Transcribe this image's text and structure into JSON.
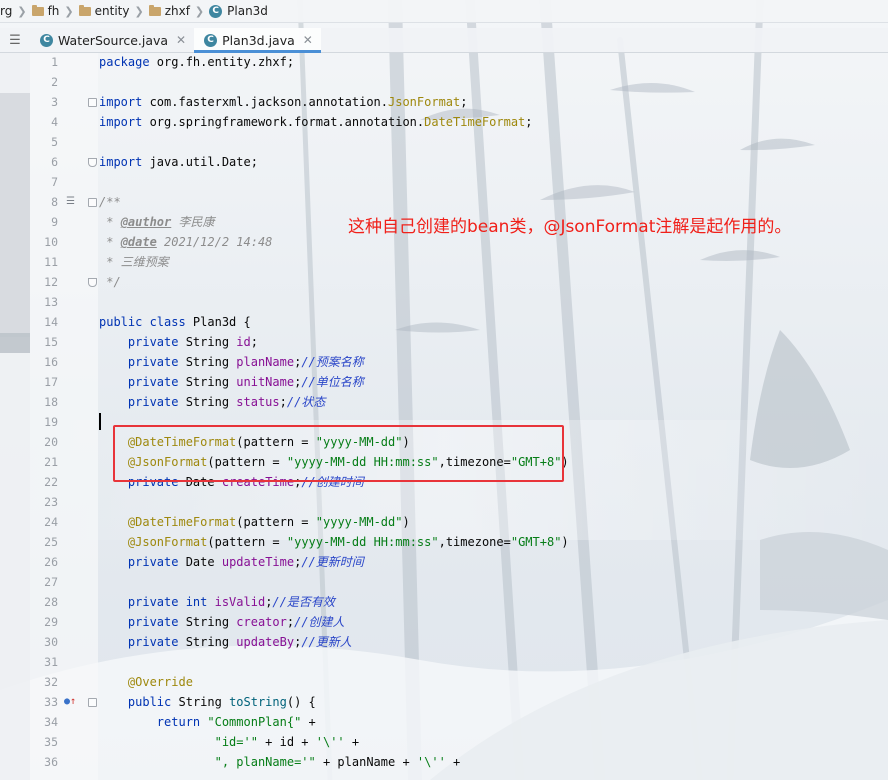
{
  "breadcrumb": {
    "items": [
      "rg",
      "fh",
      "entity",
      "zhxf",
      "Plan3d"
    ]
  },
  "tabs": [
    {
      "label": "WaterSource.java",
      "active": false
    },
    {
      "label": "Plan3d.java",
      "active": true
    }
  ],
  "annotation": {
    "note": "这种自己创建的bean类，@JsonFormat注解是起作用的。"
  },
  "colors": {
    "keyword": "#0033b3",
    "annotation": "#9e880d",
    "string": "#067d17",
    "comment": "#2a46c8",
    "field": "#871094",
    "highlight_box": "#e8343a",
    "note_text": "#f0201a"
  },
  "code": {
    "line_numbers": [
      "1",
      "2",
      "3",
      "4",
      "5",
      "6",
      "7",
      "8",
      "9",
      "10",
      "11",
      "12",
      "13",
      "14",
      "15",
      "16",
      "17",
      "18",
      "19",
      "20",
      "21",
      "22",
      "23",
      "24",
      "25",
      "26",
      "27",
      "28",
      "29",
      "30",
      "31",
      "32",
      "33",
      "34",
      "35",
      "36"
    ],
    "tokens": {
      "package_kw": "package",
      "package_name": " org.fh.entity.zhxf;",
      "import_kw": "import",
      "import1_pre": " com.fasterxml.jackson.annotation.",
      "import1_cls": "JsonFormat",
      "import2_pre": " org.springframework.format.annotation.",
      "import2_cls": "DateTimeFormat",
      "import3": " java.util.Date;",
      "semi": ";",
      "doc_open": "/**",
      "doc_star": " * ",
      "author_tag": "@author",
      "author_val": " 李民康",
      "date_tag": "@date",
      "date_val": " 2021/12/2 14:48",
      "doc_desc": " * 三维预案",
      "doc_close": " */",
      "public_class": "public class",
      "class_name": " Plan3d {",
      "private": "private",
      "type_string": " String ",
      "type_date": " Date ",
      "type_int": " int ",
      "id": "id",
      "planName": "planName",
      "unitName": "unitName",
      "status": "status",
      "createTime": "createTime",
      "updateTime": "updateTime",
      "isValid": "isValid",
      "creator": "creator",
      "updateBy": "updateBy",
      "c_planName": "//预案名称",
      "c_unitName": "//单位名称",
      "c_status": "//状态",
      "c_createTime": "//创建时间",
      "c_updateTime": "//更新时间",
      "c_isValid": "//是否有效",
      "c_creator": "//创建人",
      "c_updateBy": "//更新人",
      "dtf_ann": "@DateTimeFormat",
      "dtf_open": "(pattern = ",
      "dtf_str": "\"yyyy-MM-dd\"",
      "close_paren": ")",
      "jf_ann": "@JsonFormat",
      "jf_open": "(pattern = ",
      "jf_str": "\"yyyy-MM-dd HH:mm:ss\"",
      "jf_tz": ",timezone=",
      "jf_tz_str": "\"GMT+8\"",
      "override": "@Override",
      "public_kw": "public",
      "tostring_sig": " String ",
      "tostring_name": "toString",
      "tostring_rest": "() {",
      "return_kw": "return ",
      "ret_str": "\"CommonPlan{\"",
      "ret_plus": " +",
      "l35_str1": "\"id='\"",
      "l35_mid": " + id + ",
      "l35_str2": "'\\''",
      "l35_end": " +",
      "l36_str1": "\", planName='\"",
      "l36_mid": " + planName + ",
      "l36_str2": "'\\''",
      "l36_end": " +"
    }
  }
}
